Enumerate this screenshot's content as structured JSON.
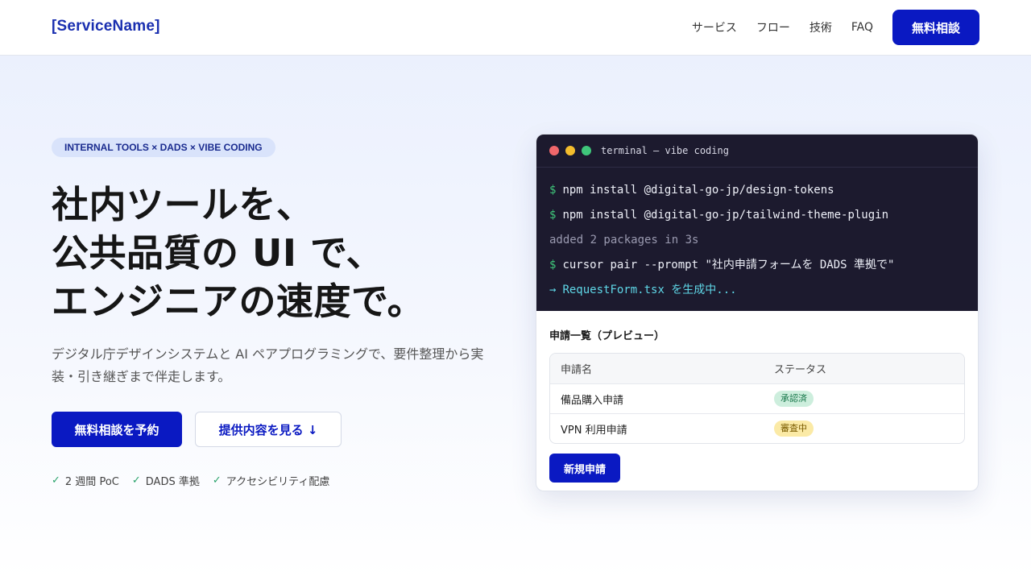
{
  "header": {
    "brand": "[ServiceName]",
    "nav": [
      "サービス",
      "フロー",
      "技術",
      "FAQ"
    ],
    "cta": "無料相談"
  },
  "hero": {
    "badge": "INTERNAL TOOLS × DADS × VIBE CODING",
    "title_lines": [
      "社内ツールを、",
      "公共品質の UI で、",
      "エンジニアの速度で。"
    ],
    "description": "デジタル庁デザインシステムと AI ペアプログラミングで、要件整理から実装・引き継ぎまで伴走します。",
    "primary_button": "無料相談を予約",
    "secondary_button": "提供内容を見る ↓",
    "checks": [
      "2 週間 PoC",
      "DADS 準拠",
      "アクセシビリティ配慮"
    ]
  },
  "terminal": {
    "title": "terminal — vibe coding",
    "prompt_symbol": "$",
    "arrow_symbol": "→",
    "lines": [
      "npm install @digital-go-jp/design-tokens",
      "npm install @digital-go-jp/tailwind-theme-plugin",
      "added 2 packages in 3s",
      "cursor pair --prompt \"社内申請フォームを DADS 準拠で\"",
      "RequestForm.tsx を生成中..."
    ]
  },
  "preview": {
    "title": "申請一覧（プレビュー）",
    "columns": [
      "申請名",
      "ステータス"
    ],
    "rows": [
      {
        "name": "備品購入申請",
        "status": "承認済"
      },
      {
        "name": "VPN 利用申請",
        "status": "審査中"
      }
    ],
    "new_button": "新規申請"
  },
  "colors": {
    "accent": "#0a19c2",
    "terminal_bg": "#1c1a2e",
    "approved": "#cdeedd",
    "pending": "#fbeaa6"
  }
}
